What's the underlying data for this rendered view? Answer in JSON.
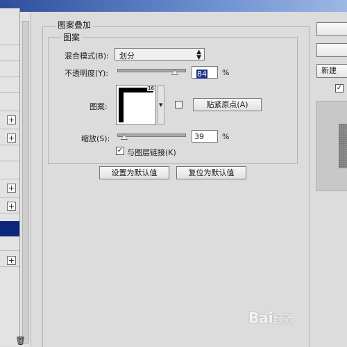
{
  "group_title": "图案叠加",
  "section_title": "图案",
  "blend_mode": {
    "label": "混合模式(B):",
    "value": "划分"
  },
  "opacity": {
    "label": "不透明度(Y):",
    "value": "84",
    "unit": "%",
    "level": 0.84
  },
  "pattern": {
    "label": "图案:",
    "corner_badge": "16",
    "snap_button": "贴紧原点(A)"
  },
  "scale": {
    "label": "缩放(S):",
    "value": "39",
    "unit": "%",
    "level": 0.39
  },
  "link_with_layer": {
    "label": "与图层链接(K)",
    "checked": true
  },
  "buttons": {
    "set_default": "设置为默认值",
    "reset_default": "复位为默认值"
  },
  "right_panel": {
    "new_button": "新建",
    "preview_checked": true
  },
  "watermark": {
    "brand": "Bai",
    "suffix": "经验"
  },
  "colors": {
    "selected_row": "#0c2779",
    "title_bar": "#2d4f9b"
  }
}
